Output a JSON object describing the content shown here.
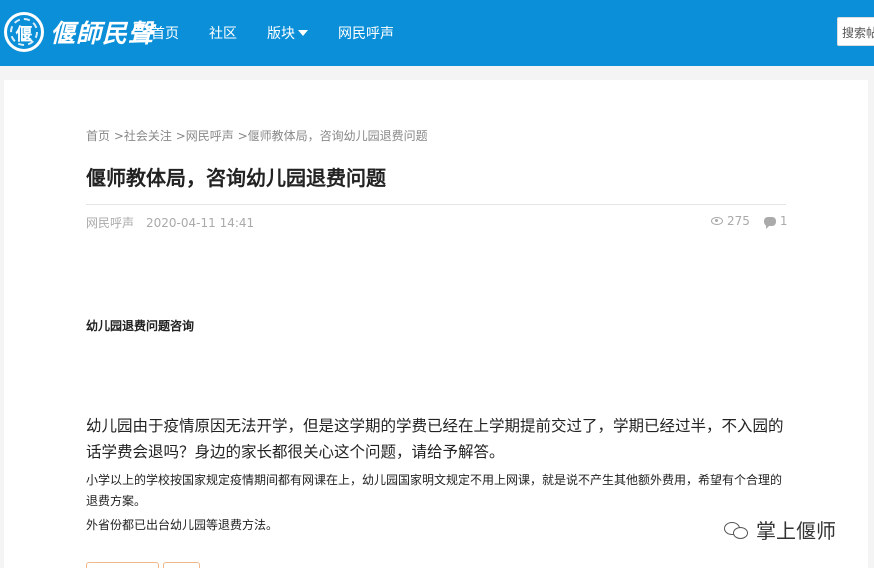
{
  "brand": {
    "logo_char": "偃",
    "logo_text": "偃師民聲",
    "color": "#0a8fd8"
  },
  "nav": {
    "items": [
      {
        "label": "首页"
      },
      {
        "label": "社区"
      },
      {
        "label": "版块",
        "dropdown": true
      },
      {
        "label": "网民呼声"
      }
    ]
  },
  "search": {
    "placeholder": "搜索帖"
  },
  "breadcrumb": {
    "home": "首页",
    "c1": " >社会关注",
    "c2": " >网民呼声",
    "c3": " >偃师教体局，咨询幼儿园退费问题"
  },
  "post": {
    "title": "偃师教体局，咨询幼儿园退费问题",
    "category": "网民呼声",
    "date": "2020-04-11 14:41",
    "views": "275",
    "comments": "1",
    "subhead": "幼儿园退费问题咨询",
    "lead": "幼儿园由于疫情原因无法开学，但是这学期的学费已经在上学期提前交过了，学期已经过半，不入园的话学费会退吗？身边的家长都很关心这个问题，请给予解答。",
    "para1": "小学以上的学校按国家规定疫情期间都有网课在上，幼儿园国家明文规定不用上网课，就是说不产生其他额外费用，希望有个合理的退费方案。",
    "para2": "外省份都已出台幼儿园等退费方法。"
  },
  "watermark": {
    "text": "掌上偃师"
  }
}
